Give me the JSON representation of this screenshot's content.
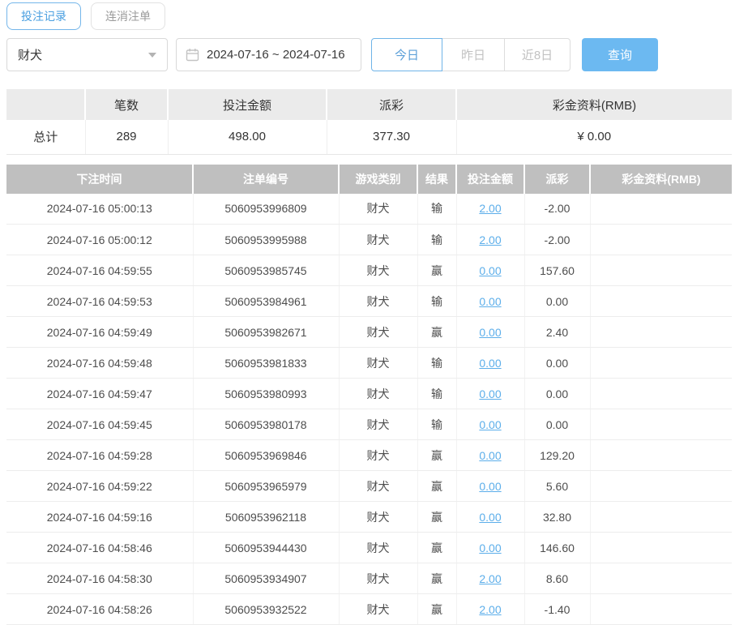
{
  "tabs": [
    {
      "label": "投注记录",
      "active": true
    },
    {
      "label": "连消注单",
      "active": false
    }
  ],
  "filters": {
    "game_select": {
      "value": "财犬"
    },
    "date_range": {
      "value": "2024-07-16 ~ 2024-07-16"
    },
    "quick_buttons": [
      {
        "label": "今日",
        "active": true
      },
      {
        "label": "昨日",
        "active": false
      },
      {
        "label": "近8日",
        "active": false
      }
    ],
    "query_label": "查询"
  },
  "summary": {
    "headers": [
      "",
      "笔数",
      "投注金额",
      "派彩",
      "彩金资料(RMB)"
    ],
    "total": {
      "label": "总计",
      "count": "289",
      "bet_amount": "498.00",
      "payout": "377.30",
      "bonus": "¥ 0.00"
    }
  },
  "table": {
    "headers": [
      "下注时间",
      "注单编号",
      "游戏类别",
      "结果",
      "投注金额",
      "派彩",
      "彩金资料(RMB)"
    ],
    "rows": [
      {
        "time": "2024-07-16 05:00:13",
        "order_no": "5060953996809",
        "game": "财犬",
        "result": "输",
        "bet": "2.00",
        "payout": "-2.00",
        "payout_negative": true,
        "bonus": ""
      },
      {
        "time": "2024-07-16 05:00:12",
        "order_no": "5060953995988",
        "game": "财犬",
        "result": "输",
        "bet": "2.00",
        "payout": "-2.00",
        "payout_negative": true,
        "bonus": ""
      },
      {
        "time": "2024-07-16 04:59:55",
        "order_no": "5060953985745",
        "game": "财犬",
        "result": "赢",
        "bet": "0.00",
        "payout": "157.60",
        "payout_negative": false,
        "bonus": ""
      },
      {
        "time": "2024-07-16 04:59:53",
        "order_no": "5060953984961",
        "game": "财犬",
        "result": "输",
        "bet": "0.00",
        "payout": "0.00",
        "payout_negative": false,
        "bonus": ""
      },
      {
        "time": "2024-07-16 04:59:49",
        "order_no": "5060953982671",
        "game": "财犬",
        "result": "赢",
        "bet": "0.00",
        "payout": "2.40",
        "payout_negative": false,
        "bonus": ""
      },
      {
        "time": "2024-07-16 04:59:48",
        "order_no": "5060953981833",
        "game": "财犬",
        "result": "输",
        "bet": "0.00",
        "payout": "0.00",
        "payout_negative": false,
        "bonus": ""
      },
      {
        "time": "2024-07-16 04:59:47",
        "order_no": "5060953980993",
        "game": "财犬",
        "result": "输",
        "bet": "0.00",
        "payout": "0.00",
        "payout_negative": false,
        "bonus": ""
      },
      {
        "time": "2024-07-16 04:59:45",
        "order_no": "5060953980178",
        "game": "财犬",
        "result": "输",
        "bet": "0.00",
        "payout": "0.00",
        "payout_negative": false,
        "bonus": ""
      },
      {
        "time": "2024-07-16 04:59:28",
        "order_no": "5060953969846",
        "game": "财犬",
        "result": "赢",
        "bet": "0.00",
        "payout": "129.20",
        "payout_negative": false,
        "bonus": ""
      },
      {
        "time": "2024-07-16 04:59:22",
        "order_no": "5060953965979",
        "game": "财犬",
        "result": "赢",
        "bet": "0.00",
        "payout": "5.60",
        "payout_negative": false,
        "bonus": ""
      },
      {
        "time": "2024-07-16 04:59:16",
        "order_no": "5060953962118",
        "game": "财犬",
        "result": "赢",
        "bet": "0.00",
        "payout": "32.80",
        "payout_negative": false,
        "bonus": ""
      },
      {
        "time": "2024-07-16 04:58:46",
        "order_no": "5060953944430",
        "game": "财犬",
        "result": "赢",
        "bet": "0.00",
        "payout": "146.60",
        "payout_negative": false,
        "bonus": ""
      },
      {
        "time": "2024-07-16 04:58:30",
        "order_no": "5060953934907",
        "game": "财犬",
        "result": "赢",
        "bet": "2.00",
        "payout": "8.60",
        "payout_negative": false,
        "bonus": ""
      },
      {
        "time": "2024-07-16 04:58:26",
        "order_no": "5060953932522",
        "game": "财犬",
        "result": "赢",
        "bet": "2.00",
        "payout": "-1.40",
        "payout_negative": true,
        "bonus": ""
      }
    ]
  },
  "colors": {
    "accent_blue": "#5caeea",
    "query_button_blue": "#6cb9f1",
    "link_blue": "#5caeea",
    "negative_red": "#e05e5e",
    "table_header_grey": "#bfbfbf",
    "summary_header_grey": "#ebebeb"
  }
}
